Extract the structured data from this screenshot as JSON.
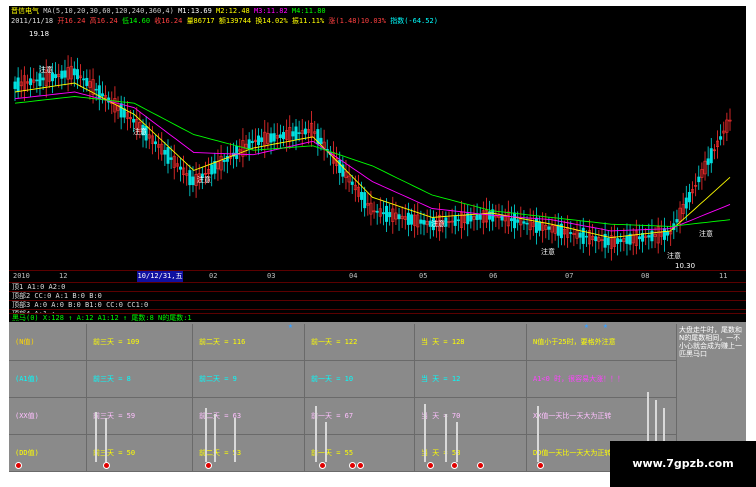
{
  "header": {
    "title": "晋信电气",
    "ma_label": "MA(5,10,20,30,60,120,240,360,4)",
    "m1": "M1:13.69",
    "m2": "M2:12.48",
    "m3": "M3:11.82",
    "m4": "M4:11.80",
    "date": "2011/11/18",
    "open": "开16.24",
    "high": "高16.24",
    "low": "低14.60",
    "close": "收16.24",
    "vol": "量86717",
    "amt": "额139744",
    "turn": "换14.02%",
    "swing": "振11.11%",
    "rise": "涨(1.48)10.03%",
    "index": "指数(-64.52)"
  },
  "price_annotations": {
    "high_label": "19.18",
    "low_label": "10.30",
    "attention": [
      "注意",
      "注意",
      "注意",
      "注意",
      "注意",
      "注意",
      "注意"
    ]
  },
  "time_axis": {
    "labels": [
      "2010",
      "12",
      "10/12/31,五",
      "02",
      "03",
      "04",
      "05",
      "06",
      "07",
      "08",
      "11"
    ],
    "selected_date": "10/12/31,五"
  },
  "indicators": [
    "顶1 A1:0 A2:0",
    "顶部2 CC:0 A:1 B:0 B:0",
    "顶部3 A:0 A:0 B:0 B1:0 CC:0 CC1:0",
    "顶部4 A:1 ↑",
    "黑马(0) X:128 ↑ A:12 A1:12 ↑ 尾数:8 N的尾数:1"
  ],
  "stats": {
    "rows": [
      {
        "label": "(N值)",
        "d3": "前三天 = 109",
        "d2": "前二天 = 116",
        "d1": "前一天 = 122",
        "d0": "当  天 = 128",
        "note": "N值小于25时，要格外注意"
      },
      {
        "label": "(A1值)",
        "d3": "前三天 = 8",
        "d2": "前二天 = 9",
        "d1": "前一天 = 10",
        "d0": "当  天 = 12",
        "note": "A1<0 时，很容易大涨！！！"
      },
      {
        "label": "(XX值)",
        "d3": "前三天 = 59",
        "d2": "前二天 = 63",
        "d1": "前一天 = 67",
        "d0": "当  天 = 70",
        "note": "XX值一天比一天大为正转"
      },
      {
        "label": "(DD值)",
        "d3": "前三天 = 50",
        "d2": "前二天 = 53",
        "d1": "前一天 = 55",
        "d0": "当  天 = 58",
        "note": "DD值一天比一天大为正转"
      }
    ],
    "side_note": "大盘走牛时，尾数和N的尾数相同，一不小心就会成为赚上一匹黑马口"
  },
  "watermark": "www.7gpzb.com",
  "chart_data": {
    "type": "line",
    "title": "",
    "x": [
      "2010-11",
      "2010-12",
      "2011-01",
      "2011-02",
      "2011-03",
      "2011-04",
      "2011-05",
      "2011-06",
      "2011-07",
      "2011-08",
      "2011-09",
      "2011-10",
      "2011-11"
    ],
    "series": [
      {
        "name": "price",
        "color": "#ffffff",
        "values": [
          17.8,
          18.4,
          16.2,
          13.5,
          15.3,
          15.8,
          12.2,
          11.6,
          12.0,
          11.4,
          10.8,
          11.2,
          16.24
        ]
      },
      {
        "name": "",
        "color": "#ffff00",
        "values": [
          17.5,
          17.9,
          16.5,
          14.0,
          15.0,
          15.5,
          12.8,
          11.9,
          12.1,
          11.6,
          11.0,
          11.3,
          13.69
        ]
      },
      {
        "name": "",
        "color": "#ff00ff",
        "values": [
          17.2,
          17.5,
          16.8,
          14.8,
          14.7,
          15.3,
          13.5,
          12.3,
          12.0,
          11.8,
          11.3,
          11.4,
          12.48
        ]
      },
      {
        "name": "",
        "color": "#00ff00",
        "values": [
          17.0,
          17.3,
          17.0,
          15.6,
          14.9,
          15.1,
          14.2,
          12.9,
          12.2,
          11.9,
          11.6,
          11.5,
          11.8
        ]
      }
    ],
    "ylim": [
      10,
      20
    ],
    "grid": false,
    "ticks_visible": false
  },
  "colors": {
    "up": "#ff3030",
    "down": "#00e0e0",
    "bg": "#000000",
    "panel": "#8a8a8a"
  }
}
